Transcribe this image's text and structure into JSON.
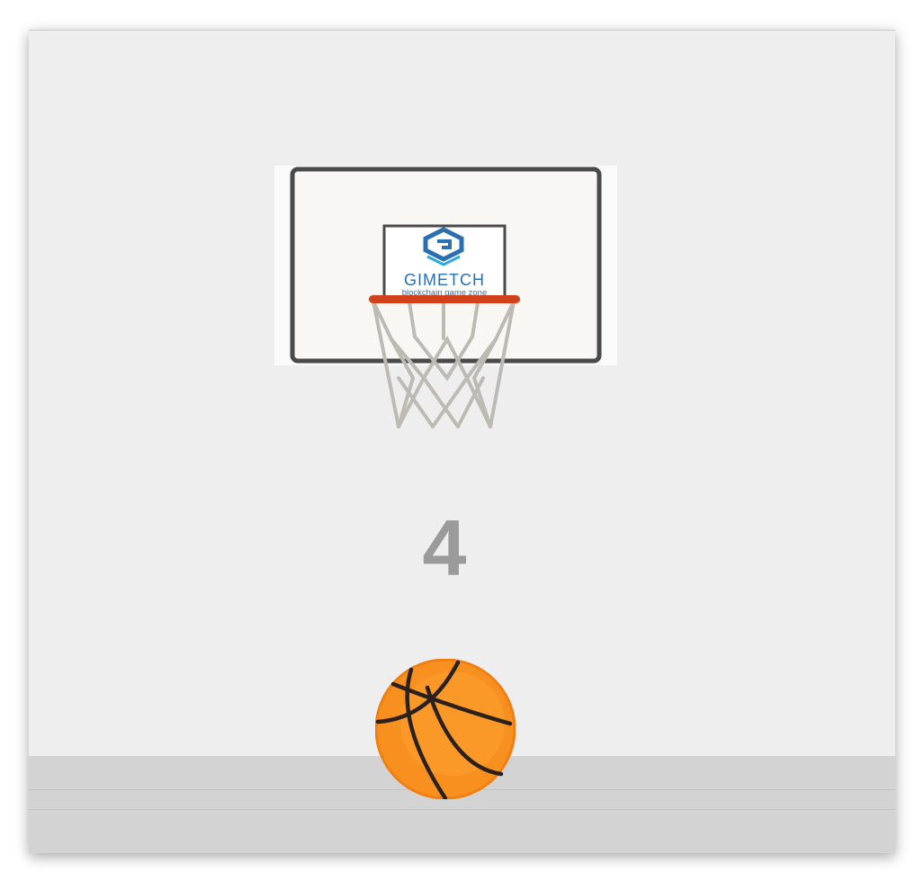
{
  "game": {
    "score": "4"
  },
  "backboard": {
    "logo": {
      "brand": "GIMETCH",
      "tagline": "blockchain game zone"
    }
  },
  "colors": {
    "background": "#eeeeee",
    "floor": "#d3d3d3",
    "backboard_frame": "#4a4a4a",
    "rim": "#d0411c",
    "net": "#bcbab2",
    "ball": "#f7901e",
    "score_text": "#9a9a9a",
    "logo_blue": "#2a6fb0"
  },
  "icons": {
    "ball": "basketball-icon",
    "logo": "gimetch-logo-icon"
  }
}
